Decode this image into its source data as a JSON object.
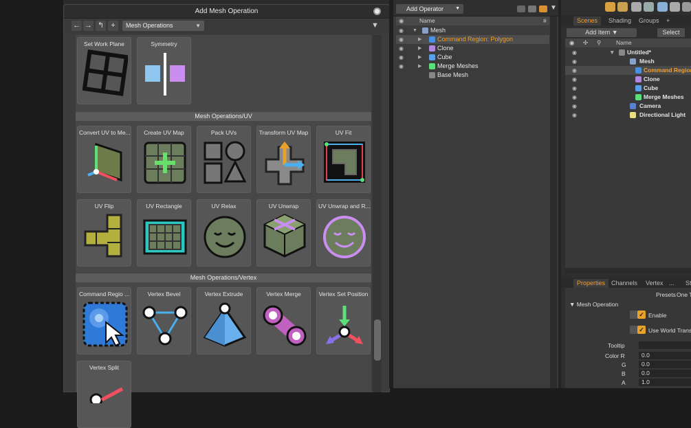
{
  "dialog": {
    "title": "Add Mesh Operation",
    "category": "Mesh Operations",
    "sections": [
      "Mesh Operations/UV",
      "Mesh Operations/Vertex"
    ],
    "tiles_top": [
      "Set Work Plane",
      "Symmetry"
    ],
    "tiles_uv1": [
      "Convert UV to Me...",
      "Create UV Map",
      "Pack UVs",
      "Transform UV Map",
      "UV Fit"
    ],
    "tiles_uv2": [
      "UV Flip",
      "UV Rectangle",
      "UV Relax",
      "UV Unwrap",
      "UV Unwrap and R..."
    ],
    "tiles_vertex": [
      "Command Regio ...",
      "Vertex Bevel",
      "Vertex Extrude",
      "Vertex Merge",
      "Vertex Set Position"
    ],
    "tiles_vertex2": [
      "Vertex Split"
    ]
  },
  "meshpanel": {
    "add_operator": "Add Operator",
    "col_name": "Name",
    "col_hash": "#",
    "rows": [
      "Mesh",
      "Command Region: Polygon",
      "Clone",
      "Cube",
      "Merge Meshes",
      "Base Mesh"
    ]
  },
  "rightpanel": {
    "tabs": [
      "Scenes",
      "Shading",
      "Groups",
      "+"
    ],
    "add_item": "Add Item",
    "select": "Select",
    "col_name": "Name",
    "rows": [
      "Untitled*",
      "Mesh",
      "Command Region:",
      "Clone",
      "Cube",
      "Merge Meshes",
      "Camera",
      "Directional Light"
    ],
    "prop_tabs": [
      "Properties",
      "Channels",
      "Vertex",
      "...",
      "St"
    ],
    "presets": "Presets",
    "one_t": "One T",
    "section": "Mesh Operation",
    "enable": "Enable",
    "use_world": "Use World Trans",
    "tooltip": "Tooltip",
    "color_r": "Color R",
    "g": "G",
    "b": "B",
    "a": "A",
    "vals": [
      "0.0",
      "0.0",
      "0.0",
      "1.0"
    ]
  }
}
